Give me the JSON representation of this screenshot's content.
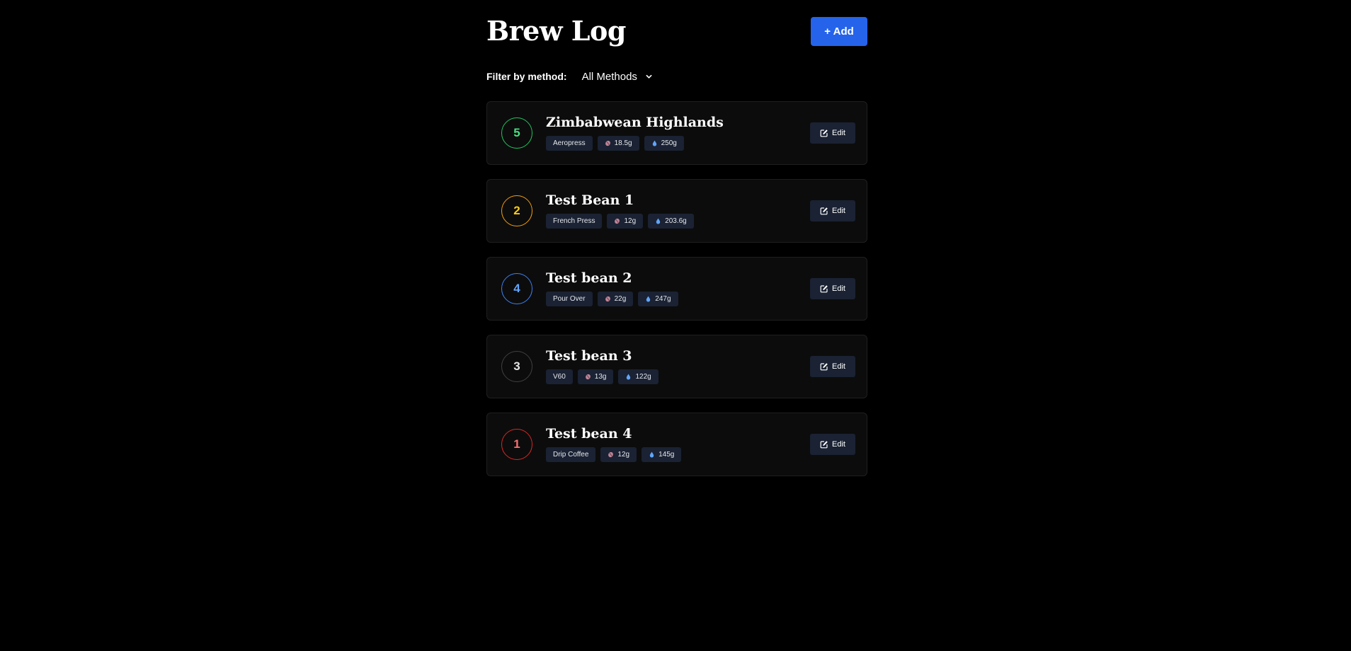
{
  "header": {
    "title": "Brew Log",
    "add_label": "+ Add"
  },
  "filter": {
    "label": "Filter by method:",
    "selected": "All Methods"
  },
  "colors": {
    "background": "#000000",
    "card": "#0c0c0c",
    "tag": "#1a2233",
    "accent": "#2563eb"
  },
  "brews": [
    {
      "rating": "5",
      "rating_color": "#22c55e",
      "rating_text_color": "#4ade80",
      "name": "Zimbabwean Highlands",
      "method": "Aeropress",
      "coffee": "18.5g",
      "water": "250g",
      "edit_label": "Edit"
    },
    {
      "rating": "2",
      "rating_color": "#f59e0b",
      "rating_text_color": "#facc15",
      "name": "Test Bean 1",
      "method": "French Press",
      "coffee": "12g",
      "water": "203.6g",
      "edit_label": "Edit"
    },
    {
      "rating": "4",
      "rating_color": "#3b82f6",
      "rating_text_color": "#60a5fa",
      "name": "Test bean 2",
      "method": "Pour Over",
      "coffee": "22g",
      "water": "247g",
      "edit_label": "Edit"
    },
    {
      "rating": "3",
      "rating_color": "#404040",
      "rating_text_color": "#e5e5e5",
      "name": "Test bean 3",
      "method": "V60",
      "coffee": "13g",
      "water": "122g",
      "edit_label": "Edit"
    },
    {
      "rating": "1",
      "rating_color": "#dc2626",
      "rating_text_color": "#f87171",
      "name": "Test bean 4",
      "method": "Drip Coffee",
      "coffee": "12g",
      "water": "145g",
      "edit_label": "Edit"
    }
  ],
  "icons": {
    "coffee": "coffee-bean-icon",
    "water": "water-drop-icon",
    "edit": "edit-icon",
    "filter_chevron": "chevron-down-icon"
  }
}
